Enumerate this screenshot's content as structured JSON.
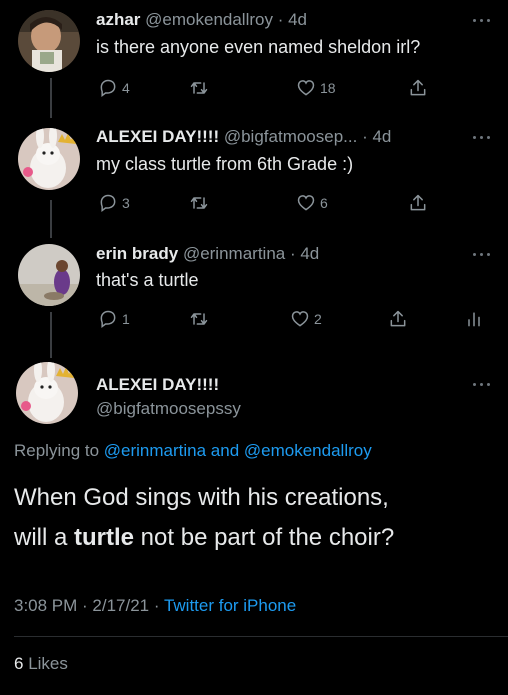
{
  "thread": [
    {
      "name": "azhar",
      "handle": "@emokendallroy",
      "time": "· 4d",
      "text": "is there anyone even named sheldon irl?",
      "replies": "4",
      "likes": "18"
    },
    {
      "name": "ALEXEI DAY!!!!",
      "handle": "@bigfatmoosep...",
      "time": "· 4d",
      "text": "my class turtle from 6th Grade :)",
      "replies": "3",
      "likes": "6"
    },
    {
      "name": "erin brady",
      "handle": "@erinmartina",
      "time": "· 4d",
      "text": "that's a turtle",
      "replies": "1",
      "likes": "2"
    }
  ],
  "main_tweet": {
    "name": "ALEXEI DAY!!!!",
    "handle": "@bigfatmoosepssy",
    "replying_prefix": "Replying to ",
    "replying_user1": "@erinmartina",
    "replying_and": " and ",
    "replying_user2": "@emokendallroy",
    "text_line1": "When God sings with his creations,",
    "text_line2_pre": "will a ",
    "text_line2_bold": "turtle",
    "text_line2_post": " not be part of the choir?",
    "timestamp": "3:08 PM · 2/17/21 · ",
    "app": "Twitter for iPhone",
    "like_count": "6",
    "like_label": " Likes"
  },
  "colors": {
    "background": "#000000",
    "accent": "#1d9bf0",
    "secondary_text": "#8b949a"
  },
  "icons": [
    "reply-icon",
    "retweet-icon",
    "like-icon",
    "share-icon",
    "analytics-icon",
    "more-icon"
  ]
}
